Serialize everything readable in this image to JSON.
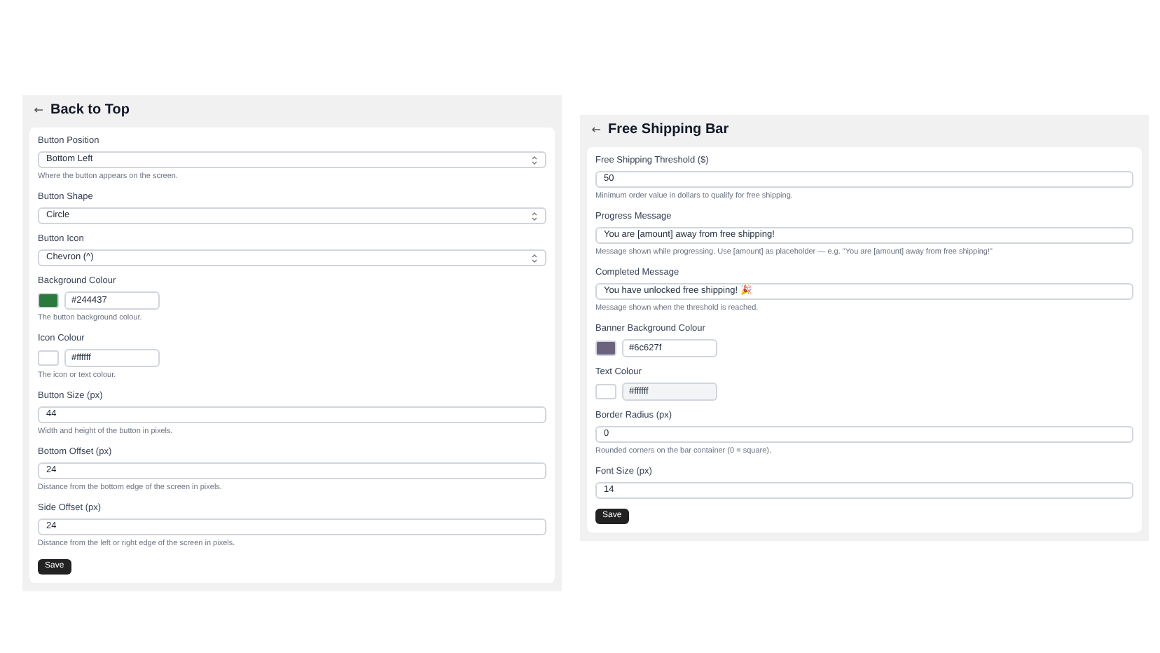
{
  "panels": [
    {
      "title": "Back to Top",
      "fields": [
        {
          "kind": "select",
          "label": "Button Position",
          "value": "Bottom Left",
          "hint": "Where the button appears on the screen."
        },
        {
          "kind": "select",
          "label": "Button Shape",
          "value": "Circle"
        },
        {
          "kind": "select",
          "label": "Button Icon",
          "value": "Chevron (^)"
        },
        {
          "kind": "color",
          "label": "Background Colour",
          "value": "#244437",
          "color": "#2a7a3b",
          "disabled": false,
          "hint": "The button background colour."
        },
        {
          "kind": "color",
          "label": "Icon Colour",
          "value": "#ffffff",
          "color": "#ffffff",
          "disabled": false,
          "hint": "The icon or text colour."
        },
        {
          "kind": "input",
          "label": "Button Size (px)",
          "value": "44",
          "hint": "Width and height of the button in pixels."
        },
        {
          "kind": "input",
          "label": "Bottom Offset (px)",
          "value": "24",
          "hint": "Distance from the bottom edge of the screen in pixels."
        },
        {
          "kind": "input",
          "label": "Side Offset (px)",
          "value": "24",
          "hint": "Distance from the left or right edge of the screen in pixels."
        }
      ],
      "button": "Save"
    },
    {
      "title": "Free Shipping Bar",
      "fields": [
        {
          "kind": "input",
          "label": "Free Shipping Threshold ($)",
          "value": "50",
          "hint": "Minimum order value in dollars to qualify for free shipping."
        },
        {
          "kind": "input",
          "label": "Progress Message",
          "value": "You are [amount] away from free shipping!",
          "hint": "Message shown while progressing. Use [amount] as placeholder — e.g. \"You are [amount] away from free shipping!\""
        },
        {
          "kind": "input",
          "label": "Completed Message",
          "value": "You have unlocked free shipping! 🎉",
          "hint": "Message shown when the threshold is reached."
        },
        {
          "kind": "color",
          "label": "Banner Background Colour",
          "value": "#6c627f",
          "color": "#6c627f",
          "disabled": false
        },
        {
          "kind": "color",
          "label": "Text Colour",
          "value": "#ffffff",
          "color": "#ffffff",
          "disabled": true
        },
        {
          "kind": "input",
          "label": "Border Radius (px)",
          "value": "0",
          "hint": "Rounded corners on the bar container (0 = square)."
        },
        {
          "kind": "input",
          "label": "Font Size (px)",
          "value": "14"
        }
      ],
      "button": "Save"
    }
  ]
}
